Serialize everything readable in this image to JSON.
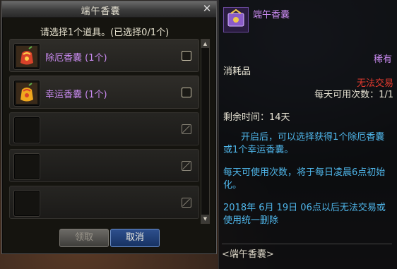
{
  "dialog": {
    "title": "端午香囊",
    "close_icon": "✕",
    "prompt": "请选择1个道具。(已选择0/1个)",
    "items": [
      {
        "label": "除厄香囊 (1个)",
        "icon": "red-sachet-icon",
        "empty": false
      },
      {
        "label": "幸运香囊 (1个)",
        "icon": "gold-sachet-icon",
        "empty": false
      },
      {
        "label": "",
        "icon": "",
        "empty": true
      },
      {
        "label": "",
        "icon": "",
        "empty": true
      },
      {
        "label": "",
        "icon": "",
        "empty": true
      }
    ],
    "scroll_up": "▲",
    "scroll_down": "▼",
    "claim_label": "领取",
    "cancel_label": "取消"
  },
  "tooltip": {
    "name": "端午香囊",
    "rarity": "稀有",
    "type": "消耗品",
    "trade": "无法交易",
    "uses": "每天可用次数：1/1",
    "remaining": "剩余时间：14天",
    "description": "开启后，可以选择获得1个除厄香囊或1个幸运香囊。",
    "daily": "每天可使用次数，将于每日凌晨6点初始化。",
    "expire": "2018年 6月 19日 06点以后无法交易或使用统一删除",
    "footer": "<端午香囊>"
  },
  "colors": {
    "rare_purple": "#c98af0",
    "untradeable_red": "#e63b2f",
    "desc_blue": "#4fb6ea"
  }
}
